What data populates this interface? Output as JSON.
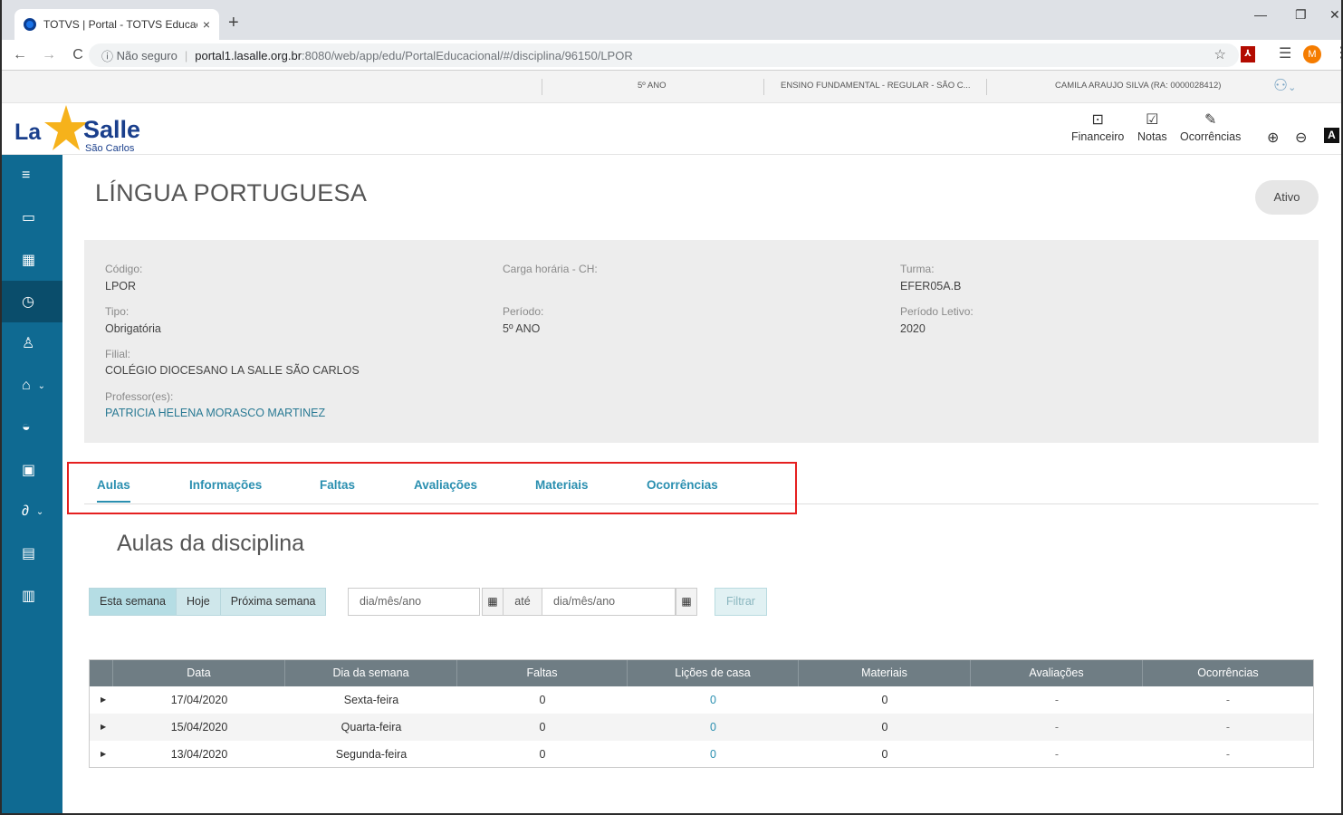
{
  "browser": {
    "tab_title": "TOTVS | Portal - TOTVS Educacional",
    "tab_close": "×",
    "new_tab": "+",
    "url_security": "Não seguro",
    "url_host": "portal1.lasalle.org.br",
    "url_path": ":8080/web/app/edu/PortalEducacional/#/disciplina/96150/LPOR",
    "avatar_letter": "M"
  },
  "infobar": {
    "period": "5º ANO",
    "course": "ENSINO FUNDAMENTAL - REGULAR - SÃO C...",
    "student": "CAMILA ARAUJO SILVA (RA: 0000028412)"
  },
  "header": {
    "logo_la": "La",
    "logo_salle": "Salle",
    "logo_sub": "São Carlos",
    "icons": [
      {
        "label": "Financeiro",
        "icon": "dollar-icon"
      },
      {
        "label": "Notas",
        "icon": "grade-icon"
      },
      {
        "label": "Ocorrências",
        "icon": "edit-icon"
      }
    ],
    "contrast_label": "A"
  },
  "sidebar": {
    "items": [
      {
        "icon": "menu-icon"
      },
      {
        "icon": "monitor-icon"
      },
      {
        "icon": "calendar-icon"
      },
      {
        "icon": "clock-icon",
        "active": true
      },
      {
        "icon": "user-check-icon"
      },
      {
        "icon": "graduation-icon",
        "expand": true
      },
      {
        "icon": "inbox-icon"
      },
      {
        "icon": "dollar-icon"
      },
      {
        "icon": "link-icon",
        "expand": true
      },
      {
        "icon": "document-icon"
      },
      {
        "icon": "table-icon"
      }
    ]
  },
  "page": {
    "title": "LÍNGUA PORTUGUESA",
    "status": "Ativo"
  },
  "details": {
    "codigo_label": "Código:",
    "codigo": "LPOR",
    "carga_label": "Carga horária - CH:",
    "turma_label": "Turma:",
    "turma": "EFER05A.B",
    "tipo_label": "Tipo:",
    "tipo": "Obrigatória",
    "periodo_label": "Período:",
    "periodo": "5º ANO",
    "letivo_label": "Período Letivo:",
    "letivo": "2020",
    "filial_label": "Filial:",
    "filial": "COLÉGIO DIOCESANO LA SALLE SÃO CARLOS",
    "prof_label": "Professor(es):",
    "prof": "PATRICIA HELENA MORASCO MARTINEZ"
  },
  "tabs": [
    "Aulas",
    "Informações",
    "Faltas",
    "Avaliações",
    "Materiais",
    "Ocorrências"
  ],
  "section": {
    "title": "Aulas da disciplina"
  },
  "filters": {
    "buttons": [
      "Esta semana",
      "Hoje",
      "Próxima semana"
    ],
    "date_placeholder": "dia/mês/ano",
    "ate": "até",
    "filtrar": "Filtrar"
  },
  "table": {
    "headers": [
      "Data",
      "Dia da semana",
      "Faltas",
      "Lições de casa",
      "Materiais",
      "Avaliações",
      "Ocorrências"
    ],
    "rows": [
      [
        "17/04/2020",
        "Sexta-feira",
        "0",
        "0",
        "0",
        "-",
        "-"
      ],
      [
        "15/04/2020",
        "Quarta-feira",
        "0",
        "0",
        "0",
        "-",
        "-"
      ],
      [
        "13/04/2020",
        "Segunda-feira",
        "0",
        "0",
        "0",
        "-",
        "-"
      ]
    ]
  }
}
